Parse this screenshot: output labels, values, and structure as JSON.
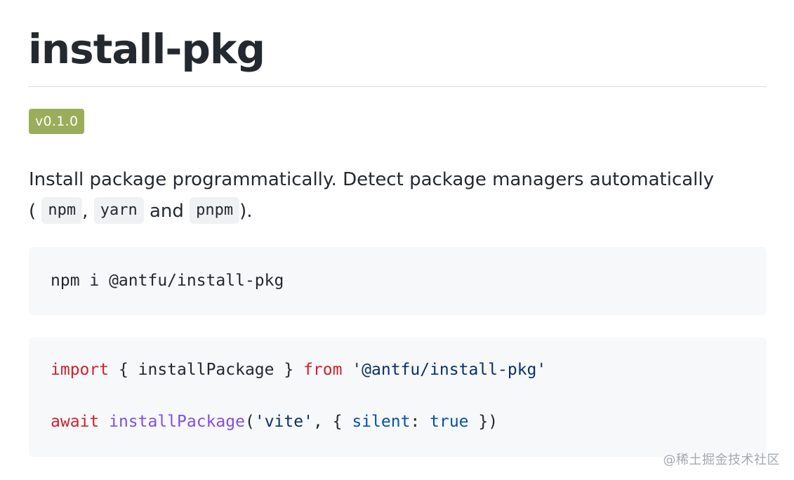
{
  "readme": {
    "title": "install-pkg",
    "badge": "v0.1.0",
    "description": {
      "text_1": "Install package programmatically. Detect package managers automatically",
      "text_2": "(",
      "code_npm": "npm",
      "sep_1": ",",
      "code_yarn": "yarn",
      "text_and": "and",
      "code_pnpm": "pnpm",
      "text_end": ")."
    },
    "shell_code": "npm i @antfu/install-pkg",
    "js_code": {
      "line1": {
        "kw_import": "import",
        "brace_open": " { ",
        "ident": "installPackage",
        "brace_close": " } ",
        "kw_from": "from",
        "space": " ",
        "str": "'@antfu/install-pkg'"
      },
      "line2": {
        "kw_await": "await",
        "space": " ",
        "fn": "installPackage",
        "paren_open": "(",
        "str": "'vite'",
        "comma_brace": ", { ",
        "prop": "silent",
        "colon": ": ",
        "bool": "true",
        "close": " })"
      }
    }
  },
  "watermark": "@稀土掘金技术社区",
  "colors": {
    "badge_bg": "#9aad5a",
    "keyword": "#cf222e",
    "function": "#8250df",
    "string": "#0a3069",
    "property": "#0550ae",
    "code_bg": "#f6f8fa"
  }
}
